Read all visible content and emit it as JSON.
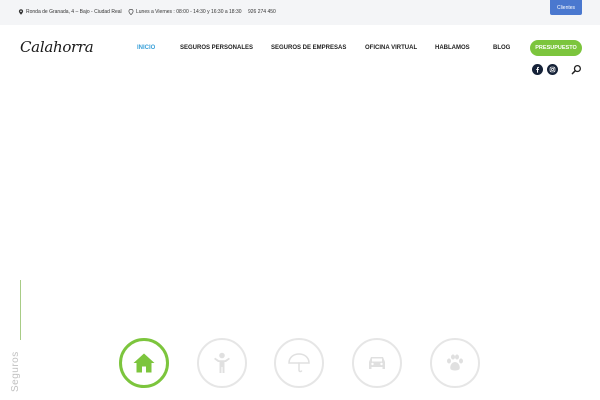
{
  "topbar": {
    "address": "Ronda de Granada, 4 – Bajo - Ciudad Real",
    "hours": "Lunes a Viernes : 08:00 - 14:30 y 16:30 a 18:30",
    "phone": "926 274 450",
    "clientes_label": "Clientes"
  },
  "header": {
    "logo_text": "Calahorra",
    "nav": [
      "INICIO",
      "SEGUROS PERSONALES",
      "SEGUROS DE EMPRESAS",
      "OFICINA VIRTUAL",
      "HABLAMOS",
      "BLOG"
    ],
    "cta_label": "PRESUPUESTO",
    "social": [
      "facebook-icon",
      "instagram-icon"
    ],
    "search_icon": "search-icon"
  },
  "section": {
    "vertical_label": "Seguros",
    "icons": [
      "home-icon",
      "person-icon",
      "umbrella-icon",
      "car-icon",
      "paw-icon"
    ]
  },
  "colors": {
    "accent_green": "#7cc53d",
    "accent_blue": "#3aa0d8",
    "button_blue": "#4a78cf",
    "dark_navy": "#152238"
  }
}
